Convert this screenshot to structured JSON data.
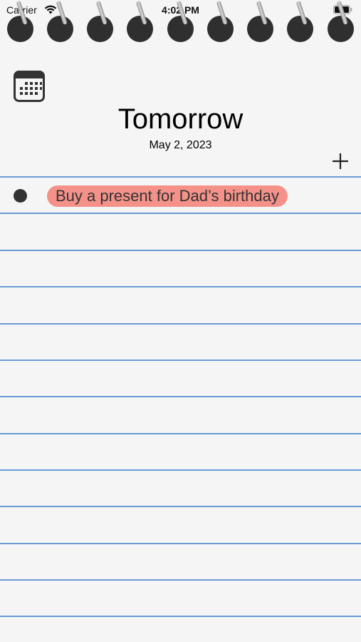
{
  "status_bar": {
    "carrier": "Carrier",
    "time": "4:02 PM"
  },
  "header": {
    "title": "Tomorrow",
    "date": "May 2, 2023"
  },
  "icons": {
    "calendar": "calendar-icon",
    "add": "plus-icon",
    "wifi": "wifi-icon",
    "battery": "battery-icon"
  },
  "tasks": [
    {
      "text": "Buy a present for Dad’s birthday",
      "highlight_color": "#f4928a"
    }
  ],
  "colors": {
    "paper": "#f5f5f5",
    "rule_line": "#6a9bd3",
    "ring": "#2f2f2f"
  }
}
